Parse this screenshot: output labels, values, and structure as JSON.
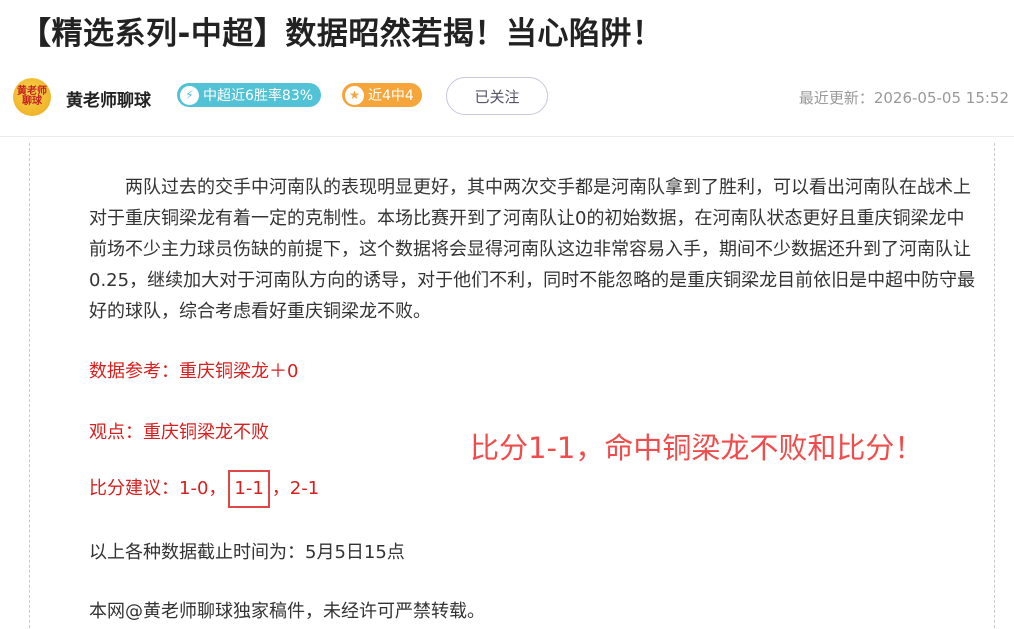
{
  "article": {
    "title": "【精选系列-中超】数据昭然若揭！当心陷阱！"
  },
  "author": {
    "avatar_text_top": "黄老师",
    "avatar_text_bottom": "聊球",
    "name": "黄老师聊球",
    "badge_rate_icon": "⚡",
    "badge_rate": "中超近6胜率83%",
    "badge_recent_icon": "★",
    "badge_recent": "近4中4",
    "follow_label": "已关注",
    "updated": "最近更新：2026-05-05 15:52"
  },
  "body": {
    "paragraph": "　　两队过去的交手中河南队的表现明显更好，其中两次交手都是河南队拿到了胜利，可以看出河南队在战术上对于重庆铜梁龙有着一定的克制性。本场比赛开到了河南队让0的初始数据，在河南队状态更好且重庆铜梁龙中前场不少主力球员伤缺的前提下，这个数据将会显得河南队这边非常容易入手，期间不少数据还升到了河南队让0.25，继续加大对于河南队方向的诱导，对于他们不利，同时不能忽略的是重庆铜梁龙目前依旧是中超中防守最好的球队，综合考虑看好重庆铜梁龙不败。",
    "data_ref": "数据参考：重庆铜梁龙＋0",
    "viewpoint": "观点：重庆铜梁龙不败",
    "score_prefix": "比分建议：1-0，",
    "score_hit": "1-1",
    "score_suffix": "，2-1",
    "deadline": "以上各种数据截止时间为：5月5日15点",
    "copyright": "本网@黄老师聊球独家稿件，未经许可严禁转载。"
  },
  "annotation": {
    "text": "比分1-1，命中铜梁龙不败和比分！",
    "color": "#f04c4c"
  },
  "colors": {
    "badge_rate": "#52c3d6",
    "badge_recent": "#f5a53a",
    "highlight_red": "#d91e1e"
  }
}
